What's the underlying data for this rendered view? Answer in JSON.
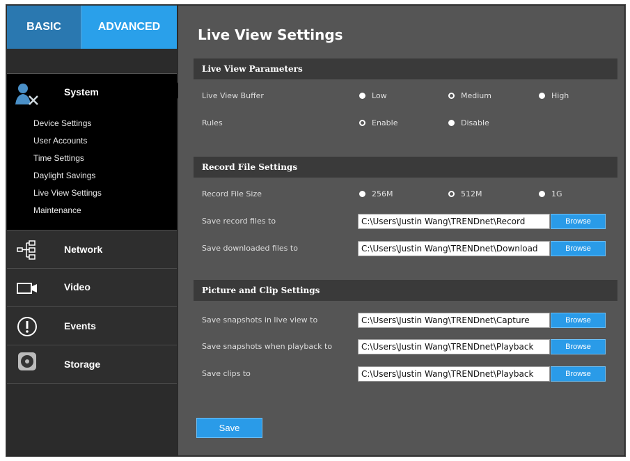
{
  "tabs": {
    "basic": "BASIC",
    "advanced": "ADVANCED"
  },
  "sidebar": {
    "system": {
      "label": "System",
      "items": [
        "Device Settings",
        "User Accounts",
        "Time Settings",
        "Daylight Savings",
        "Live View Settings",
        "Maintenance"
      ]
    },
    "network": "Network",
    "video": "Video",
    "events": "Events",
    "storage": "Storage"
  },
  "page": {
    "title": "Live View Settings"
  },
  "live_view": {
    "section": "Live View Parameters",
    "buffer_label": "Live View Buffer",
    "buffer_options": [
      "Low",
      "Medium",
      "High"
    ],
    "buffer_selected": "Medium",
    "rules_label": "Rules",
    "rules_options": [
      "Enable",
      "Disable"
    ],
    "rules_selected": "Enable"
  },
  "record": {
    "section": "Record File Settings",
    "size_label": "Record File Size",
    "size_options": [
      "256M",
      "512M",
      "1G"
    ],
    "size_selected": "512M",
    "save_record_label": "Save record files to",
    "save_record_path": "C:\\Users\\Justin Wang\\TRENDnet\\Record",
    "save_download_label": "Save downloaded files to",
    "save_download_path": "C:\\Users\\Justin Wang\\TRENDnet\\Download"
  },
  "picture": {
    "section": "Picture and Clip Settings",
    "snap_live_label": "Save snapshots in live view to",
    "snap_live_path": "C:\\Users\\Justin Wang\\TRENDnet\\Capture",
    "snap_playback_label": "Save snapshots when playback to",
    "snap_playback_path": "C:\\Users\\Justin Wang\\TRENDnet\\Playback",
    "clips_label": "Save clips to",
    "clips_path": "C:\\Users\\Justin Wang\\TRENDnet\\Playback"
  },
  "buttons": {
    "browse": "Browse",
    "save": "Save"
  },
  "colors": {
    "accent": "#2a9be8",
    "sidebar_active": "#000000",
    "panel": "#555555",
    "section_bar": "#3a3a3a"
  }
}
